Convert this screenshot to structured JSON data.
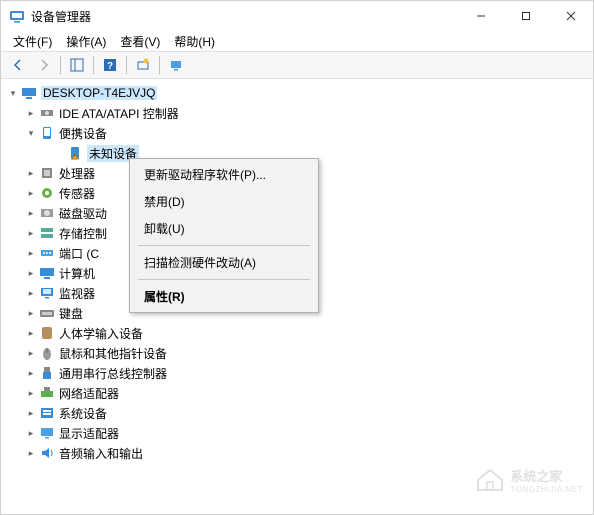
{
  "window": {
    "title": "设备管理器"
  },
  "menubar": {
    "file": "文件(F)",
    "action": "操作(A)",
    "view": "查看(V)",
    "help": "帮助(H)"
  },
  "tree": {
    "root": "DESKTOP-T4EJVJQ",
    "nodes": [
      {
        "label": "IDE ATA/ATAPI 控制器",
        "expanded": false,
        "icon": "disk-controller"
      },
      {
        "label": "便携设备",
        "expanded": true,
        "icon": "portable",
        "children": [
          {
            "label": "未知设备",
            "icon": "warning",
            "selected": true
          }
        ]
      },
      {
        "label": "处理器",
        "expanded": false,
        "icon": "cpu"
      },
      {
        "label": "传感器",
        "expanded": false,
        "icon": "sensor"
      },
      {
        "label": "磁盘驱动",
        "expanded": false,
        "icon": "disk",
        "truncated": true
      },
      {
        "label": "存储控制",
        "expanded": false,
        "icon": "storage",
        "truncated": true
      },
      {
        "label": "端口 (C",
        "expanded": false,
        "icon": "port",
        "truncated": true
      },
      {
        "label": "计算机",
        "expanded": false,
        "icon": "computer"
      },
      {
        "label": "监视器",
        "expanded": false,
        "icon": "monitor"
      },
      {
        "label": "键盘",
        "expanded": false,
        "icon": "keyboard"
      },
      {
        "label": "人体学输入设备",
        "expanded": false,
        "icon": "hid"
      },
      {
        "label": "鼠标和其他指针设备",
        "expanded": false,
        "icon": "mouse"
      },
      {
        "label": "通用串行总线控制器",
        "expanded": false,
        "icon": "usb"
      },
      {
        "label": "网络适配器",
        "expanded": false,
        "icon": "network"
      },
      {
        "label": "系统设备",
        "expanded": false,
        "icon": "system"
      },
      {
        "label": "显示适配器",
        "expanded": false,
        "icon": "display"
      },
      {
        "label": "音频输入和输出",
        "expanded": false,
        "icon": "audio"
      }
    ]
  },
  "context_menu": {
    "update_driver": "更新驱动程序软件(P)...",
    "disable": "禁用(D)",
    "uninstall": "卸载(U)",
    "scan": "扫描检测硬件改动(A)",
    "properties": "属性(R)"
  },
  "watermark": {
    "text": "系统之家",
    "url": "TONGZHIJIA.NET"
  }
}
